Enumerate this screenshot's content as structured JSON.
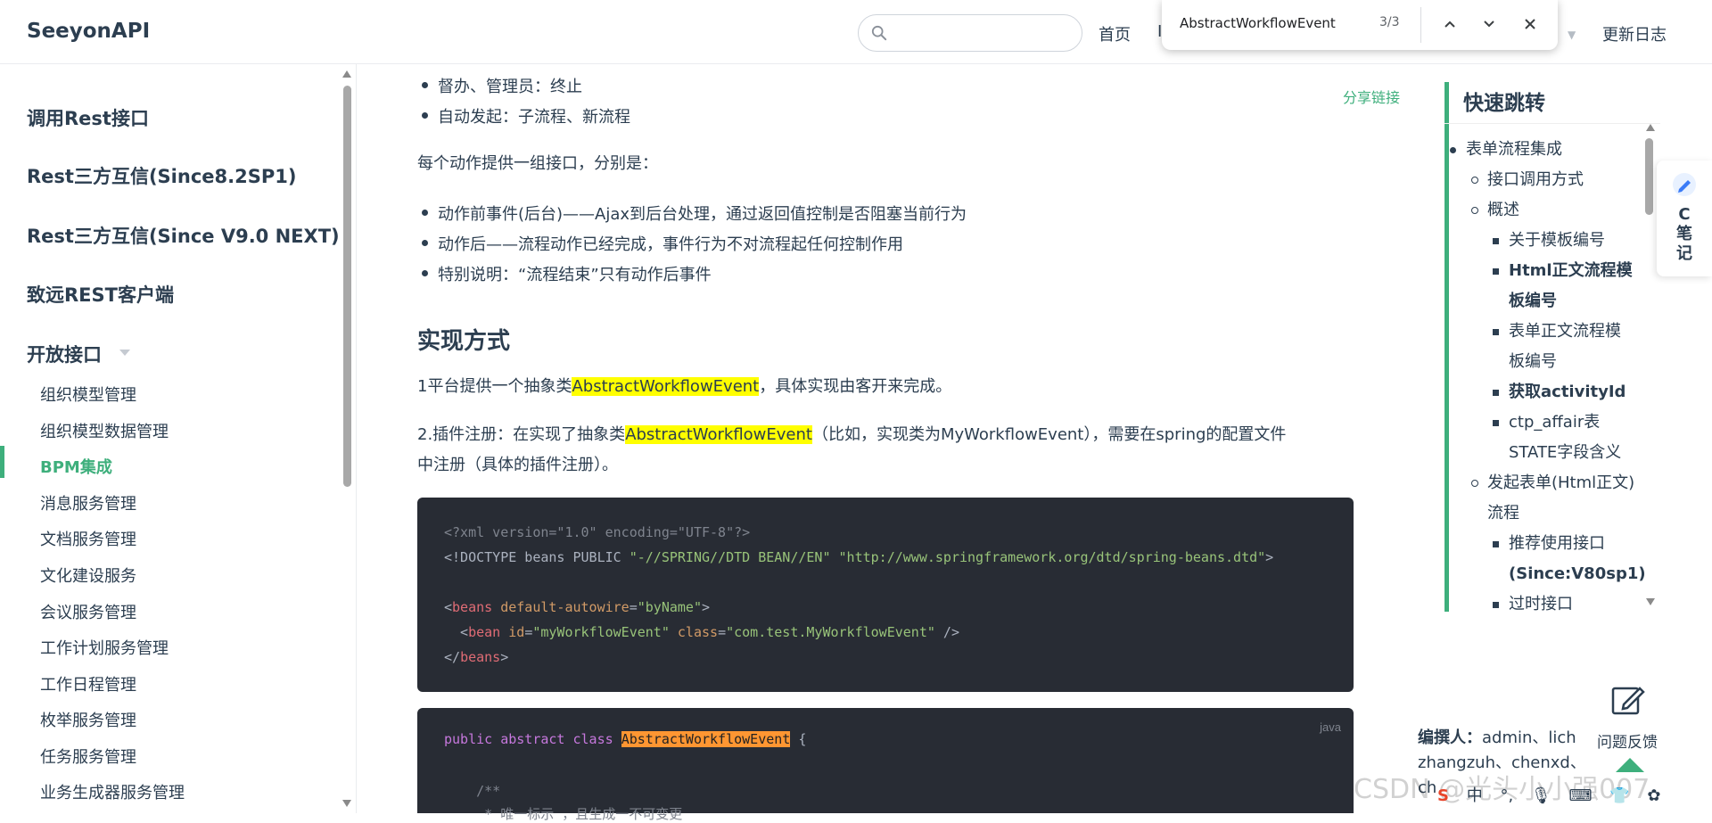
{
  "navbar": {
    "brand": "SeeyonAPI",
    "nav_home": "首页",
    "nav_partial": "I",
    "nav_changelog": "更新日志"
  },
  "findbar": {
    "query": "AbstractWorkflowEvent",
    "count": "3/3"
  },
  "sidebar": {
    "headings": [
      "调用Rest接口",
      "Rest三方互信(Since8.2SP1)",
      "Rest三方互信(Since V9.0 NEXT)",
      "致远REST客户端",
      "开放接口"
    ],
    "items": [
      "组织模型管理",
      "组织模型数据管理",
      "BPM集成",
      "消息服务管理",
      "文档服务管理",
      "文化建设服务",
      "会议服务管理",
      "工作计划服务管理",
      "工作日程管理",
      "枚举服务管理",
      "任务服务管理",
      "业务生成器服务管理"
    ],
    "active_index": 2
  },
  "content": {
    "share_link": "分享链接",
    "bullets_top": [
      "督办、管理员：终止",
      "自动发起：子流程、新流程"
    ],
    "para_actions": "每个动作提供一组接口，分别是：",
    "bullets_mid": [
      "动作前事件(后台)——Ajax到后台处理，通过返回值控制是否阻塞当前行为",
      "动作后——流程动作已经完成，事件行为不对流程起任何控制作用",
      "特别说明：“流程结束”只有动作后事件"
    ],
    "heading": "实现方式",
    "p1_pre": "1平台提供一个抽象类",
    "p1_hl": "AbstractWorkflowEvent",
    "p1_post": "，具体实现由客开来完成。",
    "p2_pre": "2.插件注册：在实现了抽象类",
    "p2_hl": "AbstractWorkflowEvent",
    "p2_post": "（比如，实现类为MyWorkflowEvent），需要在spring的配置文件",
    "p2_line2": "中注册（具体的插件注册）。",
    "code1": {
      "l1": "<?xml version=\"1.0\" encoding=\"UTF-8\"?>",
      "l2_a": "<!DOCTYPE beans PUBLIC ",
      "l2_b": "\"-//SPRING//DTD BEAN//EN\"",
      "l2_c": " ",
      "l2_d": "\"http://www.springframework.org/dtd/spring-beans.dtd\"",
      "l2_e": ">",
      "l4_a": "<",
      "l4_tag": "beans",
      "l4_attr": " default-autowire",
      "l4_eq": "=",
      "l4_val": "\"byName\"",
      "l4_end": ">",
      "l5_a": "  <",
      "l5_tag": "bean",
      "l5_attr1": " id",
      "l5_eq1": "=",
      "l5_val1": "\"myWorkflowEvent\"",
      "l5_attr2": " class",
      "l5_eq2": "=",
      "l5_val2": "\"com.test.MyWorkflowEvent\"",
      "l5_end": " />",
      "l6_a": "</",
      "l6_tag": "beans",
      "l6_end": ">"
    },
    "code2": {
      "lang": "java",
      "kw": "public abstract class ",
      "cls": "AbstractWorkflowEvent",
      "brace": " {",
      "comment1": "    /**",
      "comment2": "     * 唯一标示 ，且生成一不可变更"
    }
  },
  "toc": {
    "title": "快速跳转",
    "items": [
      {
        "text": "表单流程集成",
        "level": 1
      },
      {
        "text": "接口调用方式",
        "level": 2
      },
      {
        "text": "概述",
        "level": 2
      },
      {
        "text": "关于模板编号",
        "level": 3
      },
      {
        "text": "Html正文流程模",
        "level": 3,
        "bold": true
      },
      {
        "text": "板编号",
        "level": 0
      },
      {
        "text": "表单正文流程模",
        "level": 3
      },
      {
        "text": "板编号",
        "level": 0
      },
      {
        "text": "获取activityId",
        "level": 3
      },
      {
        "text": "ctp_affair表",
        "level": 3
      },
      {
        "text": "STATE字段含义",
        "level": 0
      },
      {
        "text": "发起表单(Html正文)",
        "level": 2
      },
      {
        "text": "流程",
        "level": 0
      },
      {
        "text": "推荐使用接口",
        "level": 3
      },
      {
        "text": "(Since:V80sp1)",
        "level": 0
      },
      {
        "text": "过时接口",
        "level": 3
      }
    ]
  },
  "widgets": {
    "note_label": "C笔记",
    "feedback": "问题反馈",
    "editors_label": "编撰人：",
    "editors_line1": "admin、lich",
    "editors_line2": "zhangzuh、chenxd、",
    "editors_line3": "ch",
    "watermark": "CSDN @光头小小强007",
    "taskbar_items": [
      "S",
      "中",
      "°,",
      "🎙",
      "⌨",
      "👕",
      "✿"
    ]
  },
  "colors": {
    "accent": "#3eaf7c",
    "highlight": "#ffff00",
    "code_bg": "#282c34",
    "current_match": "#ff9632"
  }
}
